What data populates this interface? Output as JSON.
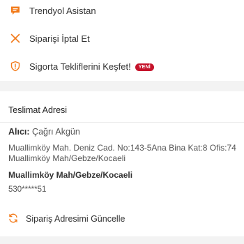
{
  "actions": {
    "assistant": {
      "label": "Trendyol Asistan",
      "icon": "chat-icon"
    },
    "cancel": {
      "label": "Siparişi İptal Et",
      "icon": "close-icon"
    },
    "insurance": {
      "label": "Sigorta Tekliflerini Keşfet!",
      "icon": "shield-icon",
      "badge": "YENİ"
    }
  },
  "address": {
    "title": "Teslimat Adresi",
    "recipient_key": "Alıcı:",
    "recipient_name": "Çağrı Akgün",
    "full_address": "Muallimköy Mah. Deniz Cad. No:143-5Ana Bina Kat:8 Ofis:74 Muallimköy Mah/Gebze/Kocaeli",
    "district": "Muallimköy Mah/Gebze/Kocaeli",
    "phone": "530*****51",
    "update_label": "Sipariş Adresimi Güncelle"
  },
  "colors": {
    "accent": "#f27a1a",
    "badge": "#c5132b",
    "background": "#f3f3f3"
  }
}
